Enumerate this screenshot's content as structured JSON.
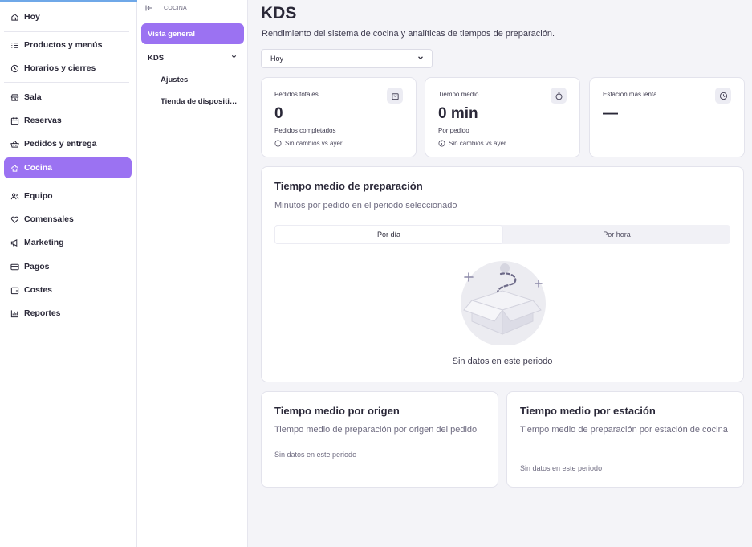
{
  "sidebar": {
    "items": [
      {
        "label": "Hoy",
        "icon": "home-icon"
      },
      {
        "label": "Productos y menús",
        "icon": "list-icon"
      },
      {
        "label": "Horarios y cierres",
        "icon": "clock-icon"
      },
      {
        "label": "Sala",
        "icon": "store-icon"
      },
      {
        "label": "Reservas",
        "icon": "calendar-icon"
      },
      {
        "label": "Pedidos y entrega",
        "icon": "basket-icon"
      },
      {
        "label": "Cocina",
        "icon": "chef-hat-icon"
      },
      {
        "label": "Equipo",
        "icon": "users-icon"
      },
      {
        "label": "Comensales",
        "icon": "heart-icon"
      },
      {
        "label": "Marketing",
        "icon": "megaphone-icon"
      },
      {
        "label": "Pagos",
        "icon": "credit-card-icon"
      },
      {
        "label": "Costes",
        "icon": "wallet-icon"
      },
      {
        "label": "Reportes",
        "icon": "chart-icon"
      }
    ],
    "active": "Cocina",
    "accent_color": "#9b72f2"
  },
  "subnav": {
    "section_label": "COCINA",
    "overview_label": "Vista general",
    "kds_label": "KDS",
    "kds_children": [
      "Ajustes",
      "Tienda de dispositivos"
    ]
  },
  "header": {
    "title": "KDS",
    "subtitle": "Rendimiento del sistema de cocina y analíticas de tiempos de preparación."
  },
  "period_select": {
    "value": "Hoy"
  },
  "stats": [
    {
      "label": "Pedidos totales",
      "value": "0",
      "sub": "Pedidos completados",
      "change": "Sin cambios vs ayer",
      "icon": "bag-icon"
    },
    {
      "label": "Tiempo medio",
      "value": "0 min",
      "sub": "Por pedido",
      "change": "Sin cambios vs ayer",
      "icon": "stopwatch-icon"
    },
    {
      "label": "Estación más lenta",
      "value": "—",
      "icon": "clock-icon"
    }
  ],
  "prep_time": {
    "title": "Tiempo medio de preparación",
    "description": "Minutos por pedido en el periodo seleccionado",
    "tabs": [
      "Por día",
      "Por hora"
    ],
    "active_tab": "Por día",
    "empty": "Sin datos en este periodo"
  },
  "by_origin": {
    "title": "Tiempo medio por origen",
    "description": "Tiempo medio de preparación por origen del pedido",
    "empty": "Sin datos en este periodo"
  },
  "by_station": {
    "title": "Tiempo medio por estación",
    "description": "Tiempo medio de preparación por estación de cocina",
    "empty": "Sin datos en este periodo"
  }
}
